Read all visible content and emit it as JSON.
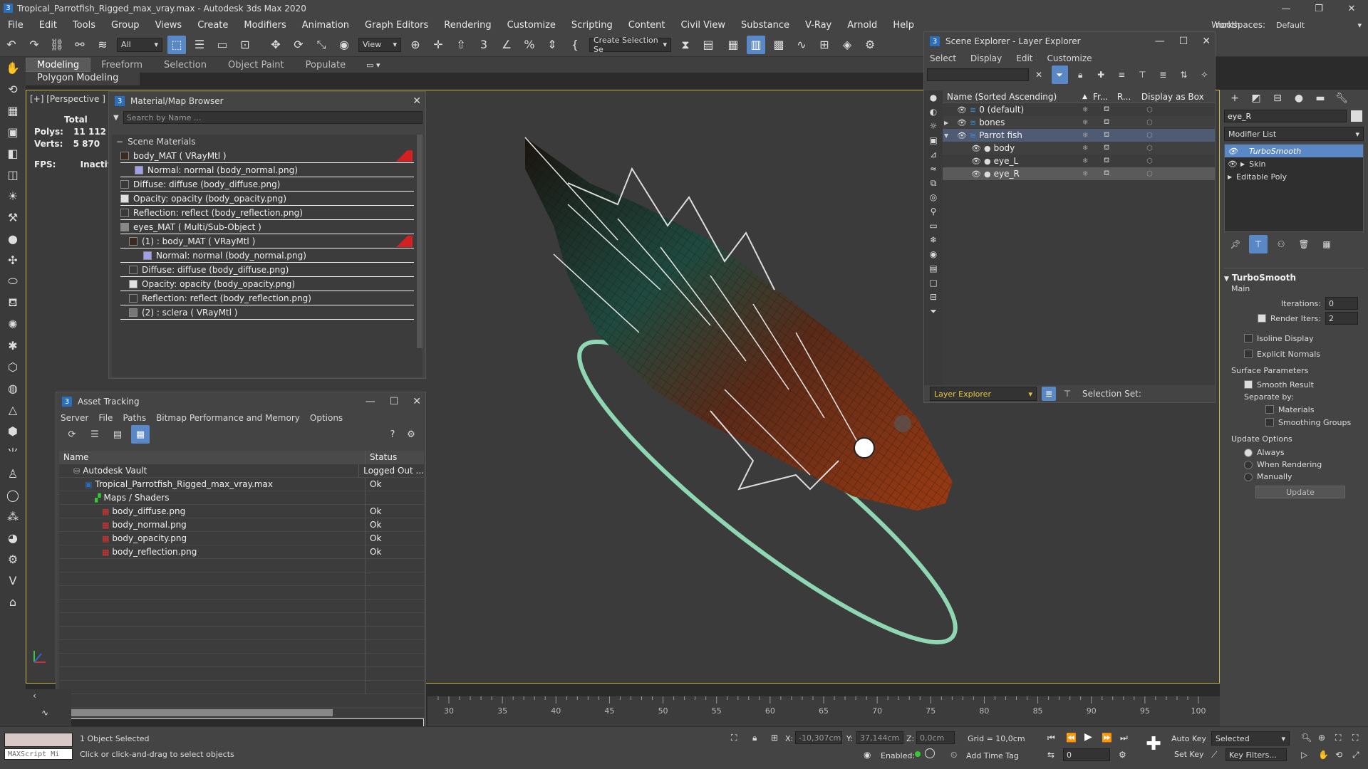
{
  "window": {
    "title": "Tropical_Parrotfish_Rigged_max_vray.max - Autodesk 3ds Max 2020",
    "workspaces_label": "Workspaces:",
    "workspace_value": "Default",
    "partial_text": "nooth"
  },
  "menu": [
    "File",
    "Edit",
    "Tools",
    "Group",
    "Views",
    "Create",
    "Modifiers",
    "Animation",
    "Graph Editors",
    "Rendering",
    "Customize",
    "Scripting",
    "Content",
    "Civil View",
    "Substance",
    "V-Ray",
    "Arnold",
    "Help"
  ],
  "toolbar": {
    "filter_value": "All",
    "view_value": "View",
    "selection_set": "Create Selection Se"
  },
  "ribbon": {
    "tabs": [
      "Modeling",
      "Freeform",
      "Selection",
      "Object Paint",
      "Populate"
    ],
    "sub": "Polygon Modeling"
  },
  "viewport": {
    "label": "[+] [Perspective ] [St",
    "stats": {
      "total_label": "Total",
      "polys_label": "Polys:",
      "polys_value": "11 112",
      "verts_label": "Verts:",
      "verts_value": "5 870",
      "fps_label": "FPS:",
      "fps_value": "Inactive"
    }
  },
  "material_browser": {
    "title": "Material/Map Browser",
    "search_placeholder": "Search by Name ...",
    "section": "Scene Materials",
    "rows": [
      {
        "text": "body_MAT  ( VRayMtl )",
        "swatch": "#3a2a20"
      },
      {
        "text": "Normal: normal (body_normal.png)",
        "swatch": "#9fa0ea"
      },
      {
        "text": "Diffuse: diffuse (body_diffuse.png)",
        "swatch": "#3a3a3a"
      },
      {
        "text": "Opacity: opacity (body_opacity.png)",
        "swatch": "#e0e0e0"
      },
      {
        "text": "Reflection: reflect (body_reflection.png)",
        "swatch": "#3a3a3a"
      },
      {
        "text": "eyes_MAT  ( Multi/Sub-Object )",
        "swatch": "#888888"
      },
      {
        "text": "(1) : body_MAT  ( VRayMtl )",
        "swatch": "#3a2a20"
      },
      {
        "text": "Normal: normal (body_normal.png)",
        "swatch": "#9fa0ea"
      },
      {
        "text": "Diffuse: diffuse (body_diffuse.png)",
        "swatch": "#3a3a3a"
      },
      {
        "text": "Opacity: opacity (body_opacity.png)",
        "swatch": "#e0e0e0"
      },
      {
        "text": "Reflection: reflect (body_reflection.png)",
        "swatch": "#3a3a3a"
      },
      {
        "text": "(2) : sclera  ( VRayMtl )",
        "swatch": "#777777"
      }
    ]
  },
  "asset_tracking": {
    "title": "Asset Tracking",
    "menu": [
      "Server",
      "File",
      "Paths",
      "Bitmap Performance and Memory",
      "Options"
    ],
    "col_name": "Name",
    "col_status": "Status",
    "rows": [
      {
        "name": "Autodesk Vault",
        "status": "Logged Out ..."
      },
      {
        "name": "Tropical_Parrotfish_Rigged_max_vray.max",
        "status": "Ok"
      },
      {
        "name": "Maps / Shaders",
        "status": ""
      },
      {
        "name": "body_diffuse.png",
        "status": "Ok"
      },
      {
        "name": "body_normal.png",
        "status": "Ok"
      },
      {
        "name": "body_opacity.png",
        "status": "Ok"
      },
      {
        "name": "body_reflection.png",
        "status": "Ok"
      }
    ]
  },
  "scene_explorer": {
    "title": "Scene Explorer - Layer Explorer",
    "menu": [
      "Select",
      "Display",
      "Edit",
      "Customize"
    ],
    "col_name": "Name (Sorted Ascending)",
    "col_fr": "Fr...",
    "col_r": "R...",
    "col_box": "Display as Box",
    "layers": [
      "0 (default)",
      "bones",
      "Parrot fish",
      "body",
      "eye_L",
      "eye_R"
    ],
    "footer_dropdown": "Layer Explorer",
    "selection_set_label": "Selection Set:"
  },
  "command_panel": {
    "object_name": "eye_R",
    "modifier_list": "Modifier List",
    "stack": [
      "TurboSmooth",
      "Skin",
      "Editable Poly"
    ],
    "rollout_title": "TurboSmooth",
    "main_label": "Main",
    "iterations_label": "Iterations:",
    "iterations_value": "0",
    "render_iters_label": "Render Iters:",
    "render_iters_value": "2",
    "isoline": "Isoline Display",
    "explicit": "Explicit Normals",
    "surface_params": "Surface Parameters",
    "smooth_result": "Smooth Result",
    "separate_by": "Separate by:",
    "materials": "Materials",
    "smoothing_groups": "Smoothing Groups",
    "update_options": "Update Options",
    "always": "Always",
    "when_rendering": "When Rendering",
    "manually": "Manually",
    "update_button": "Update"
  },
  "timeline": {
    "ticks": [
      "30",
      "35",
      "40",
      "45",
      "50",
      "55",
      "60",
      "65",
      "70",
      "75",
      "80",
      "85",
      "90",
      "95",
      "100"
    ]
  },
  "status": {
    "maxscript": "MAXScript Mi",
    "selected": "1 Object Selected",
    "prompt": "Click or click-and-drag to select objects",
    "x_label": "X:",
    "x_value": "-10,307cm",
    "y_label": "Y:",
    "y_value": "37,144cm",
    "z_label": "Z:",
    "z_value": "0,0cm",
    "grid": "Grid = 10,0cm",
    "enabled": "Enabled:",
    "add_time_tag": "Add Time Tag",
    "auto_key": "Auto Key",
    "set_key": "Set Key",
    "selected_dd": "Selected",
    "key_filters": "Key Filters...",
    "frame_value": "0"
  }
}
